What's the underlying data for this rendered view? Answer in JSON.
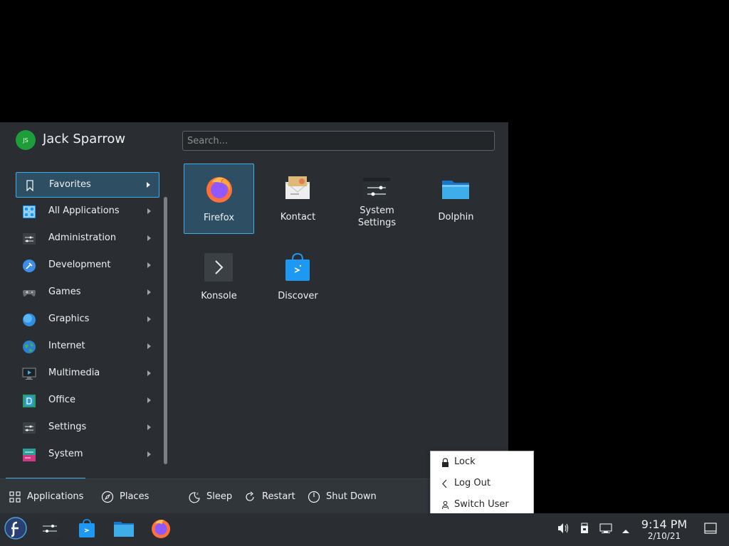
{
  "user": {
    "name": "Jack Sparrow",
    "initials": "JS"
  },
  "search": {
    "placeholder": "Search..."
  },
  "sidebar": {
    "items": [
      {
        "label": "Favorites",
        "icon": "bookmark-icon"
      },
      {
        "label": "All Applications",
        "icon": "grid-icon"
      },
      {
        "label": "Administration",
        "icon": "sliders-icon"
      },
      {
        "label": "Development",
        "icon": "hammer-icon"
      },
      {
        "label": "Games",
        "icon": "gamepad-icon"
      },
      {
        "label": "Graphics",
        "icon": "graphics-icon"
      },
      {
        "label": "Internet",
        "icon": "globe-icon"
      },
      {
        "label": "Multimedia",
        "icon": "monitor-icon"
      },
      {
        "label": "Office",
        "icon": "office-icon"
      },
      {
        "label": "Settings",
        "icon": "sliders-icon"
      },
      {
        "label": "System",
        "icon": "system-icon"
      }
    ]
  },
  "apps": [
    {
      "label": "Firefox",
      "icon": "firefox-icon"
    },
    {
      "label": "Kontact",
      "icon": "kontact-icon"
    },
    {
      "label": "System Settings",
      "icon": "system-settings-icon"
    },
    {
      "label": "Dolphin",
      "icon": "folder-icon"
    },
    {
      "label": "Konsole",
      "icon": "terminal-icon"
    },
    {
      "label": "Discover",
      "icon": "discover-bag-icon"
    }
  ],
  "footer": {
    "applications": "Applications",
    "places": "Places",
    "sleep": "Sleep",
    "restart": "Restart",
    "shutdown": "Shut Down"
  },
  "leave_menu": {
    "items": [
      {
        "label": "Lock",
        "icon": "lock-icon"
      },
      {
        "label": "Log Out",
        "icon": "chevron-left-icon"
      },
      {
        "label": "Switch User",
        "icon": "switch-user-icon"
      }
    ]
  },
  "taskbar": {
    "apps": [
      "fedora-launcher-icon",
      "system-settings-icon",
      "discover-bag-icon",
      "folder-icon",
      "firefox-icon"
    ],
    "tray": [
      "volume-icon",
      "usb-icon",
      "network-icon",
      "expand-up-icon"
    ],
    "clock": {
      "time": "9:14 PM",
      "date": "2/10/21"
    },
    "show_desktop": "show-desktop-icon"
  },
  "colors": {
    "accent": "#3daee9",
    "panel": "#2a2e32",
    "selection": "#2e4e64",
    "background": "#000000"
  }
}
